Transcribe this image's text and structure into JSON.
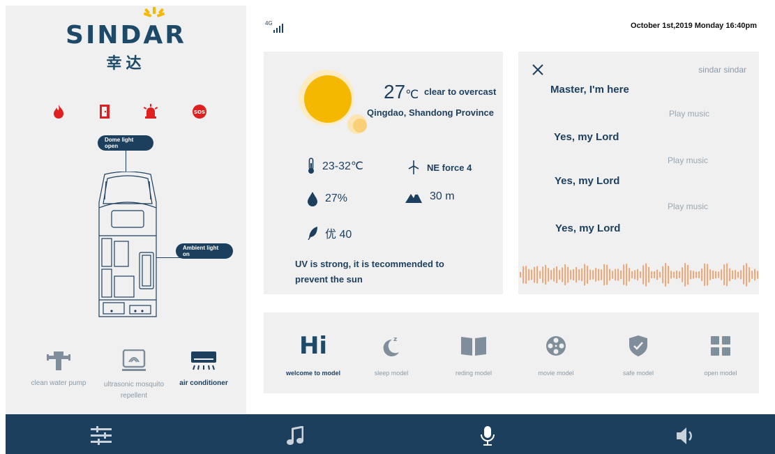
{
  "brand": {
    "name": "SINDAR",
    "name_cn": "幸达"
  },
  "status": {
    "network": "4G",
    "datetime": "October 1st,2019 Monday 16:40pm"
  },
  "alarms": [
    "fire-icon",
    "door-icon",
    "alarm-light-icon",
    "sos-icon"
  ],
  "vehicle": {
    "dome_label": "Dome light open",
    "ambient_label": "Ambient light on"
  },
  "devices": [
    {
      "label": "clean water pump",
      "icon": "water-pump-icon",
      "active": false
    },
    {
      "label": "ultrasonic  mosquito repellent",
      "icon": "mosquito-repellent-icon",
      "active": false
    },
    {
      "label": "air conditioner",
      "icon": "air-conditioner-icon",
      "active": true
    }
  ],
  "weather": {
    "temperature": "27",
    "unit": "℃",
    "condition": "clear to overcast",
    "location": "Qingdao, Shandong Province",
    "range": "23-32℃",
    "wind": "NE force 4",
    "humidity": "27%",
    "altitude": "30 m",
    "aqi": "优  40",
    "uv_advice": "UV is strong, it is tecommended to prevent the sun"
  },
  "voice": {
    "name": "sindar  sindar",
    "lines": [
      "Master, I'm here",
      "Yes, my Lord",
      "Yes, my Lord",
      "Yes, my Lord"
    ],
    "commands": [
      "Play music",
      "Play music",
      "Play music"
    ]
  },
  "modes": [
    {
      "title": "Hi",
      "label": "welcome to model",
      "icon": "",
      "active": true
    },
    {
      "title": "",
      "label": "sleep model",
      "icon": "moon-icon",
      "active": false
    },
    {
      "title": "",
      "label": "reding model",
      "icon": "book-icon",
      "active": false
    },
    {
      "title": "",
      "label": "movie  model",
      "icon": "film-reel-icon",
      "active": false
    },
    {
      "title": "",
      "label": "safe  model",
      "icon": "shield-check-icon",
      "active": false
    },
    {
      "title": "",
      "label": "open  model",
      "icon": "grid-icon",
      "active": false
    }
  ],
  "bottom_nav": [
    "sliders-icon",
    "music-note-icon",
    "microphone-icon",
    "speaker-icon"
  ],
  "colors": {
    "primary": "#1d3f5e",
    "alarm": "#e02020",
    "sun": "#f5b800",
    "panel": "#f0f0f0"
  }
}
